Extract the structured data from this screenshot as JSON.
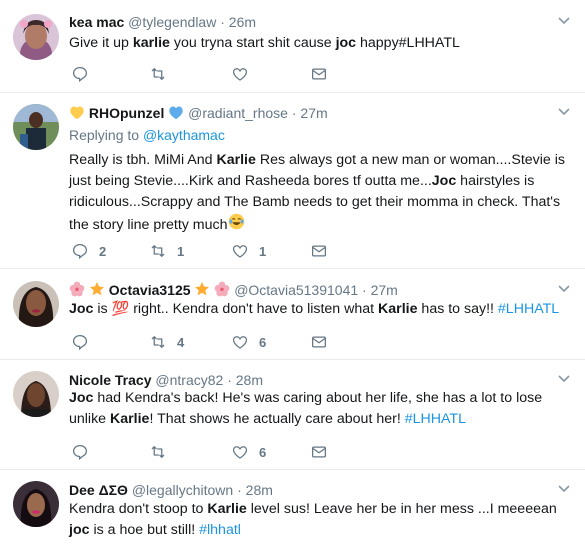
{
  "tweets": [
    {
      "name": "kea mac",
      "handle": "@tylegendlaw",
      "time": "26m",
      "text": [
        {
          "t": "Give it up "
        },
        {
          "b": "karlie"
        },
        {
          "t": " you tryna start shit cause "
        },
        {
          "b": "joc"
        },
        {
          "t": " happy#LHHATL"
        }
      ],
      "replies": "",
      "retweets": "",
      "likes": ""
    },
    {
      "name": "RHOpunzel",
      "handle": "@radiant_rhose",
      "time": "27m",
      "replying_label": "Replying to ",
      "replying_to": "@kaythamac",
      "text": [
        {
          "t": "Really is tbh. MiMi And "
        },
        {
          "b": "Karlie"
        },
        {
          "t": " Res always got a new man or woman....Stevie is just being Stevie....Kirk and Rasheeda bores tf outta me..."
        },
        {
          "b": "Joc"
        },
        {
          "t": " hairstyles is ridiculous...Scrappy and The Bamb needs to get their momma in check. That's the story line pretty much"
        }
      ],
      "replies": "2",
      "retweets": "1",
      "likes": "1"
    },
    {
      "name": "Octavia3125",
      "handle": "@Octavia51391041",
      "time": "27m",
      "text": [
        {
          "b": "Joc"
        },
        {
          "t": " is "
        },
        {
          "e": "💯"
        },
        {
          "t": " right.. Kendra don't have to listen what "
        },
        {
          "b": "Karlie"
        },
        {
          "t": " has to say!! "
        },
        {
          "h": "#LHHATL"
        }
      ],
      "replies": "",
      "retweets": "4",
      "likes": "6"
    },
    {
      "name": "Nicole Tracy",
      "handle": "@ntracy82",
      "time": "28m",
      "text": [
        {
          "b": "Joc"
        },
        {
          "t": " had Kendra's back! He's was caring about her life, she has a lot to lose unlike "
        },
        {
          "b": "Karlie"
        },
        {
          "t": "! That shows he actually care about her! "
        },
        {
          "h": "#LHHATL"
        }
      ],
      "replies": "",
      "retweets": "",
      "likes": "6"
    },
    {
      "name": "Dee ΔΣΘ",
      "handle": "@legallychitown",
      "time": "28m",
      "text": [
        {
          "t": "Kendra don't stoop to "
        },
        {
          "b": "Karlie"
        },
        {
          "t": " level sus! Leave her be in her mess ...I meeeean "
        },
        {
          "b": "joc"
        },
        {
          "t": " is a hoe but still! "
        },
        {
          "h": "#lhhatl"
        }
      ],
      "replies": "",
      "retweets": "",
      "likes": ""
    }
  ],
  "separator": "·",
  "colors": {
    "text": "#14171a",
    "muted": "#657786",
    "link": "#1b95e0",
    "like_heart": "#e0245e",
    "border": "#e6ecf0"
  },
  "icons": [
    "reply-icon",
    "retweet-icon",
    "heart-icon",
    "message-icon",
    "caret-down-icon",
    "yellow-heart-emoji",
    "blue-heart-emoji",
    "cherry-blossom-emoji",
    "star-emoji",
    "hundred-points-emoji",
    "joy-emoji"
  ]
}
